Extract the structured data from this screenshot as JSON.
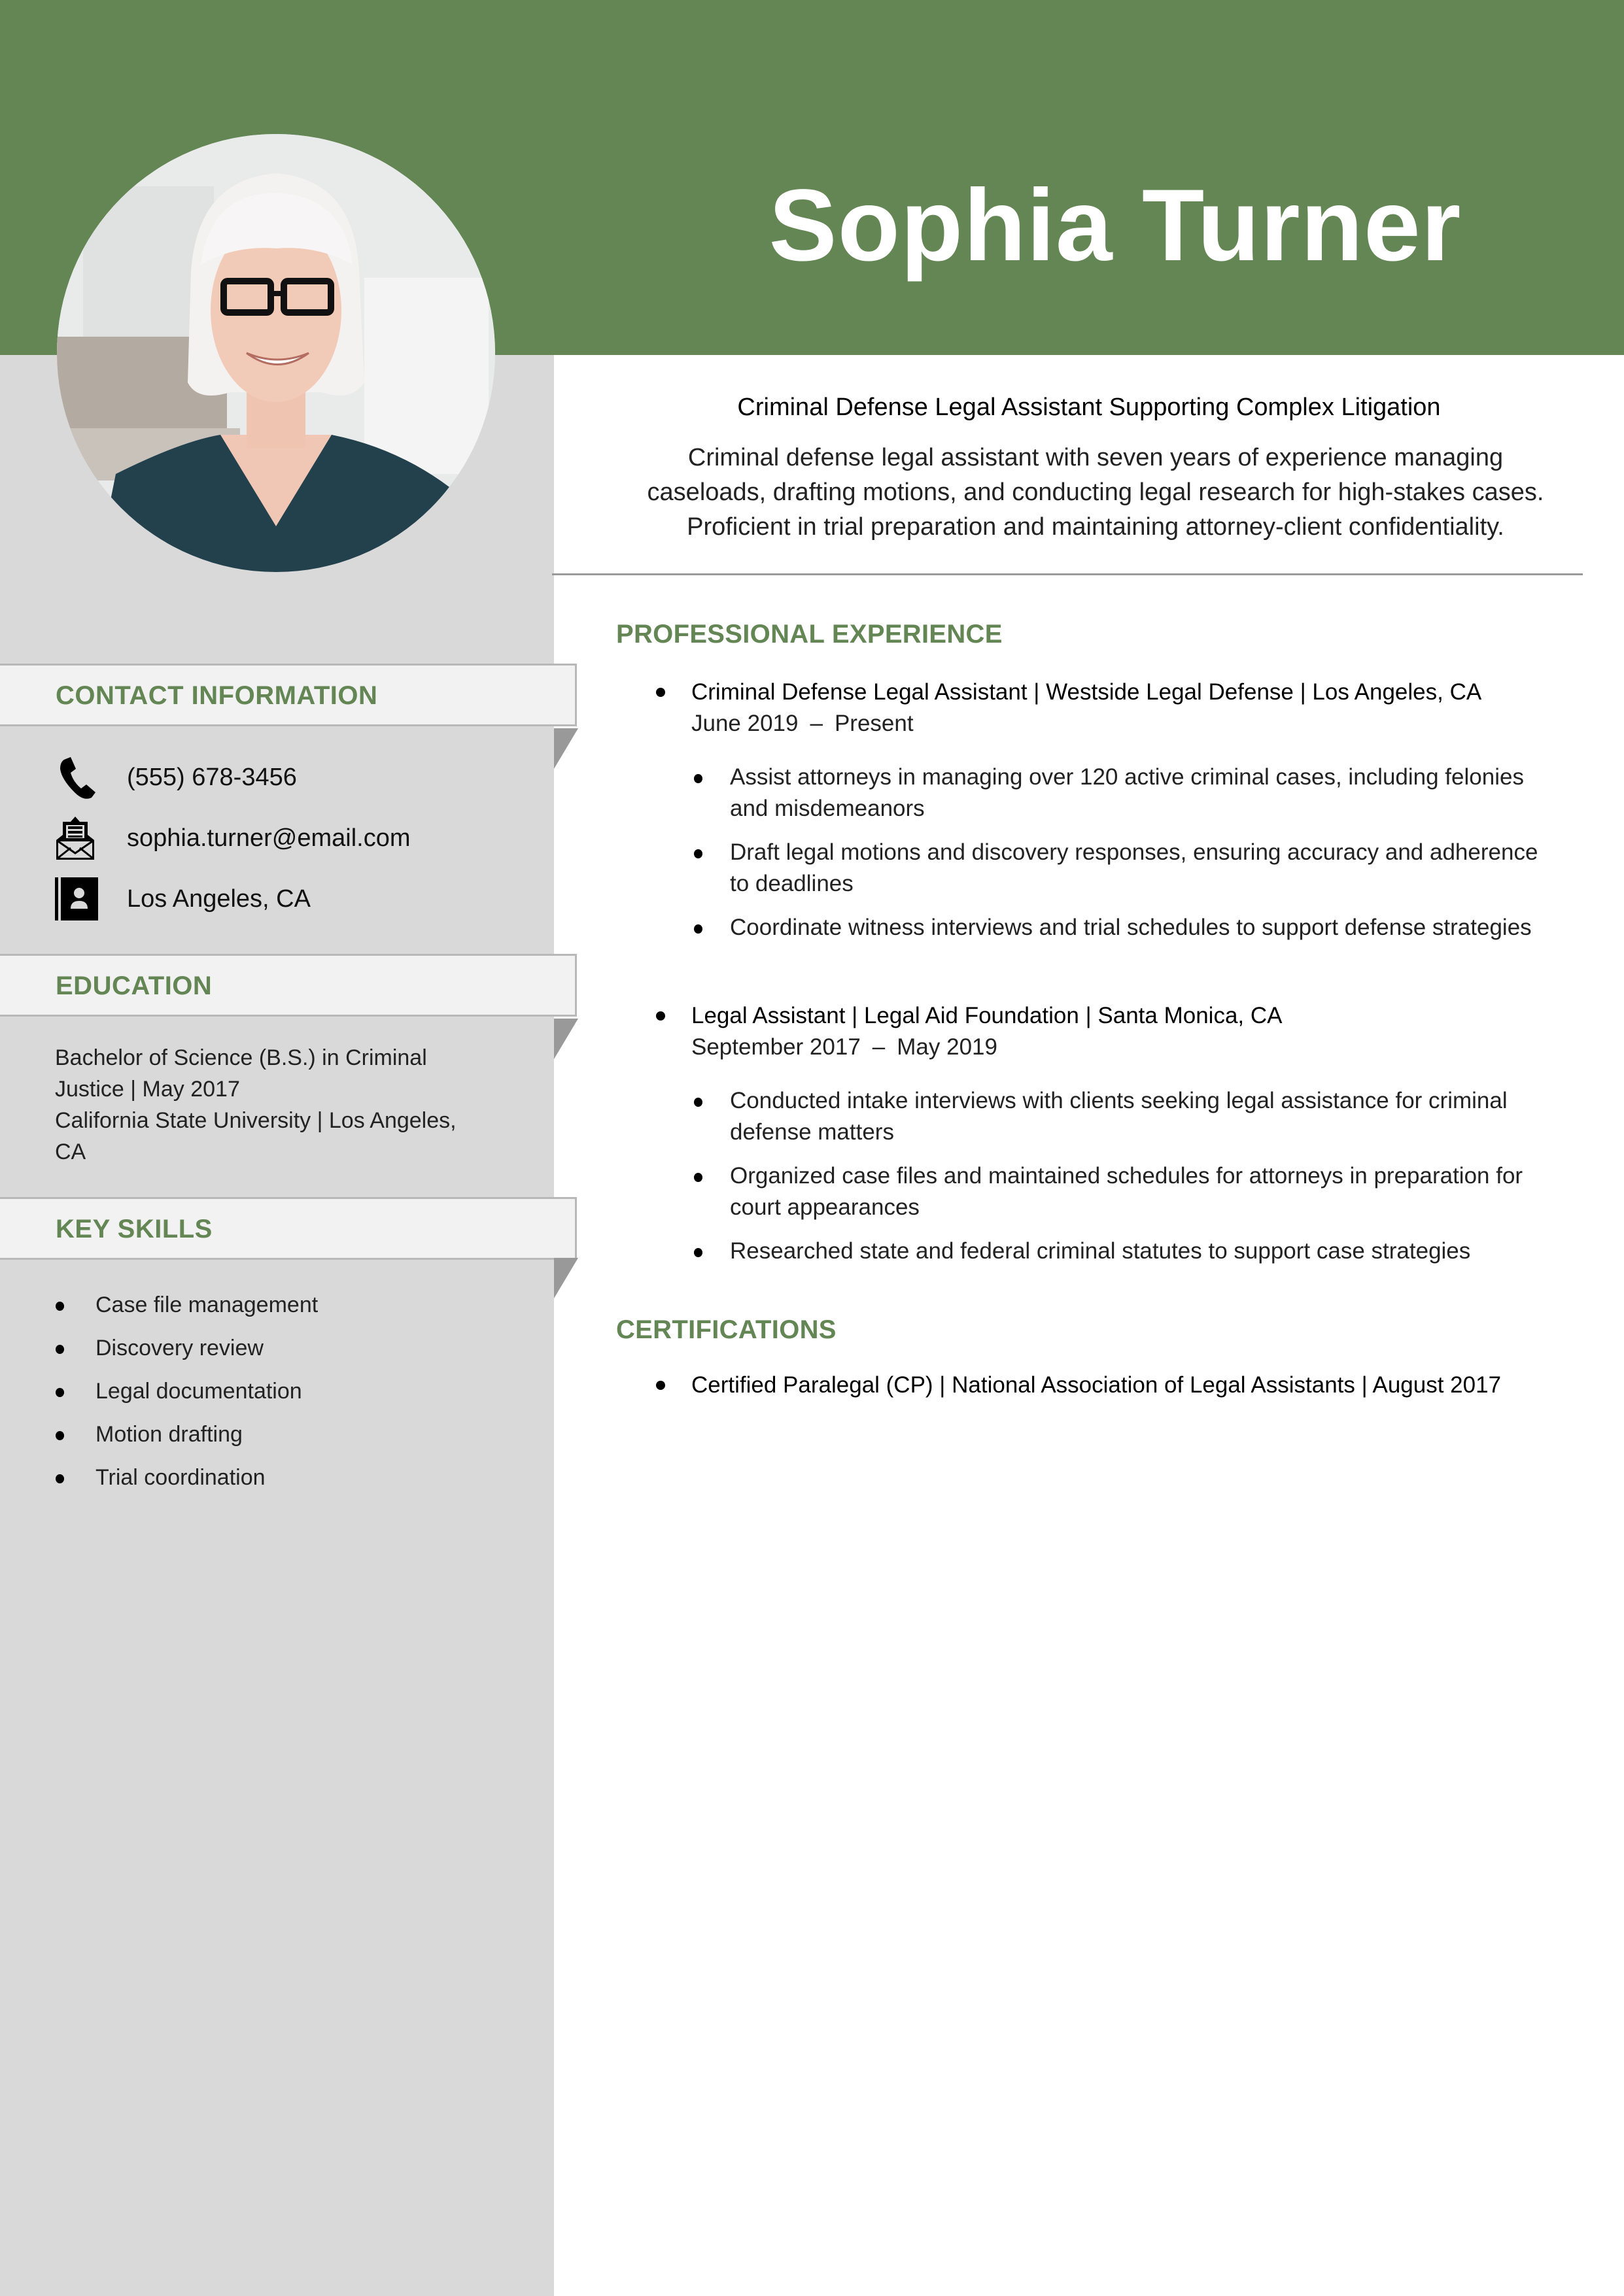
{
  "colors": {
    "accent_green": "#638654",
    "sidebar_gray": "#D9D9D9",
    "banner_bg": "#F2F2F2",
    "divider_gray": "#999999"
  },
  "header": {
    "name": "Sophia Turner",
    "photo_alt": "Profile photo of Sophia Turner"
  },
  "intro": {
    "headline": "Criminal Defense Legal Assistant Supporting Complex Litigation",
    "summary_lines": [
      "Criminal defense legal assistant with seven years of experience managing",
      "caseloads, drafting motions, and conducting legal research for high-stakes cases.",
      "Proficient in trial preparation and maintaining attorney-client confidentiality."
    ]
  },
  "sidebar": {
    "contact": {
      "title": "CONTACT INFORMATION",
      "items": [
        {
          "icon": "phone-icon",
          "text": "(555) 678-3456"
        },
        {
          "icon": "email-icon",
          "text": "sophia.turner@email.com"
        },
        {
          "icon": "address-book-icon",
          "text": "Los Angeles, CA"
        }
      ]
    },
    "education": {
      "title": "EDUCATION",
      "lines": [
        "Bachelor of Science (B.S.) in Criminal",
        "Justice | May 2017",
        "California State University | Los Angeles,",
        "CA"
      ]
    },
    "skills": {
      "title": "KEY SKILLS",
      "items": [
        "Case file management",
        "Discovery review",
        "Legal documentation",
        "Motion drafting",
        "Trial coordination"
      ]
    }
  },
  "experience": {
    "title": "PROFESSIONAL EXPERIENCE",
    "jobs": [
      {
        "heading": "Criminal Defense Legal Assistant | Westside Legal Defense | Los Angeles, CA",
        "start": "June 2019",
        "dash": "–",
        "end": "Present",
        "bullets": [
          "Assist attorneys in managing over 120 active criminal cases, including felonies and misdemeanors",
          "Draft legal motions and discovery responses, ensuring accuracy and adherence to deadlines",
          "Coordinate witness interviews and trial schedules to support defense strategies"
        ]
      },
      {
        "heading": "Legal Assistant | Legal Aid Foundation | Santa Monica, CA",
        "start": "September 2017",
        "dash": "–",
        "end": "May 2019",
        "bullets": [
          "Conducted intake interviews with clients seeking legal assistance for criminal defense matters",
          "Organized case files and maintained schedules for attorneys in preparation for court appearances",
          "Researched state and federal criminal statutes to support case strategies"
        ]
      }
    ]
  },
  "certifications": {
    "title": "CERTIFICATIONS",
    "items": [
      "Certified Paralegal (CP) | National Association of Legal Assistants | August 2017"
    ]
  }
}
